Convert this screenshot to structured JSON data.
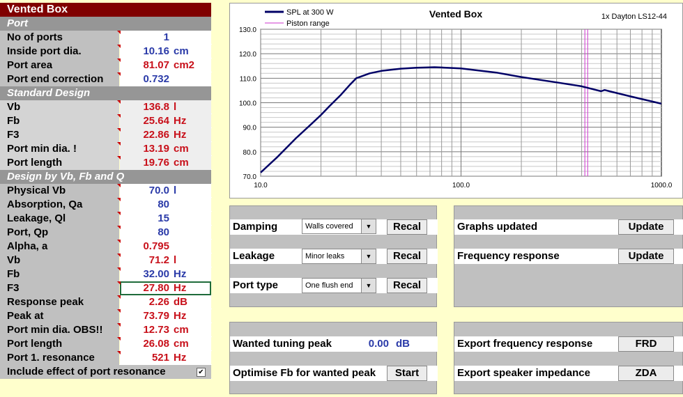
{
  "sheet": {
    "title": "Vented Box",
    "port_section": "Port",
    "port": [
      {
        "label": "No of ports",
        "value": "1",
        "unit": "",
        "color": "blue"
      },
      {
        "label": "Inside port dia.",
        "value": "10.16",
        "unit": "cm",
        "color": "blue"
      },
      {
        "label": "Port area",
        "value": "81.07",
        "unit": "cm2",
        "color": "red"
      },
      {
        "label": "Port end correction",
        "value": "0.732",
        "unit": "",
        "color": "blue"
      }
    ],
    "standard_section": "Standard Design",
    "standard": [
      {
        "label": "Vb",
        "value": "136.8",
        "unit": "l",
        "color": "red"
      },
      {
        "label": "Fb",
        "value": "25.64",
        "unit": "Hz",
        "color": "red"
      },
      {
        "label": "F3",
        "value": "22.86",
        "unit": "Hz",
        "color": "red"
      },
      {
        "label": "Port min dia. !",
        "value": "13.19",
        "unit": "cm",
        "color": "red"
      },
      {
        "label": "Port length",
        "value": "19.76",
        "unit": "cm",
        "color": "red"
      }
    ],
    "design_section": "Design by Vb, Fb and Q",
    "design": [
      {
        "label": "Physical Vb",
        "value": "70.0",
        "unit": "l",
        "color": "blue"
      },
      {
        "label": "Absorption, Qa",
        "value": "80",
        "unit": "",
        "color": "blue"
      },
      {
        "label": "Leakage, Ql",
        "value": "15",
        "unit": "",
        "color": "blue"
      },
      {
        "label": "Port, Qp",
        "value": "80",
        "unit": "",
        "color": "blue"
      },
      {
        "label": "Alpha, a",
        "value": "0.795",
        "unit": "",
        "color": "red"
      },
      {
        "label": "Vb",
        "value": "71.2",
        "unit": "l",
        "color": "red"
      },
      {
        "label": "Fb",
        "value": "32.00",
        "unit": "Hz",
        "color": "blue"
      },
      {
        "label": "F3",
        "value": "27.80",
        "unit": "Hz",
        "color": "red"
      },
      {
        "label": "Response peak",
        "value": "2.26",
        "unit": "dB",
        "color": "red"
      },
      {
        "label": "Peak at",
        "value": "73.79",
        "unit": "Hz",
        "color": "red"
      },
      {
        "label": "Port min dia. OBS!!",
        "value": "12.73",
        "unit": "cm",
        "color": "red"
      },
      {
        "label": "Port length",
        "value": "26.08",
        "unit": "cm",
        "color": "red"
      },
      {
        "label": "Port 1. resonance",
        "value": "521",
        "unit": "Hz",
        "color": "red"
      }
    ],
    "include_label": "Include effect of port resonance",
    "include_checked": true,
    "include_mark": "✔"
  },
  "chart_data": {
    "type": "line",
    "title": "Vented Box",
    "subtitle": "1x Dayton LS12-44",
    "legend": [
      {
        "name": "SPL at 300 W",
        "color": "#000066"
      },
      {
        "name": "Piston range",
        "color": "#cc33cc"
      }
    ],
    "legend_placement": "top-left",
    "xscale": "log",
    "xlim": [
      10,
      1000
    ],
    "ylim": [
      70,
      130
    ],
    "xticks": [
      "10.0",
      "100.0",
      "1000.0"
    ],
    "yticks": [
      "70.0",
      "80.0",
      "90.0",
      "100.0",
      "110.0",
      "120.0",
      "130.0"
    ],
    "grid": true,
    "piston_range_hz": 415,
    "series": [
      {
        "name": "SPL at 300 W",
        "x": [
          10,
          12,
          15,
          18,
          20,
          22,
          25,
          28,
          30,
          35,
          40,
          50,
          60,
          73.8,
          80,
          100,
          150,
          200,
          300,
          400,
          500,
          521,
          550,
          700,
          1000
        ],
        "y": [
          71.5,
          77.5,
          85.5,
          91.5,
          95.0,
          98.5,
          103.0,
          107.5,
          110.0,
          112.0,
          113.0,
          113.9,
          114.3,
          114.5,
          114.4,
          114.0,
          112.3,
          110.5,
          108.3,
          106.7,
          104.7,
          105.2,
          104.7,
          102.6,
          99.6
        ]
      }
    ]
  },
  "controls": {
    "damping_label": "Damping",
    "damping_value": "Walls covered",
    "leakage_label": "Leakage",
    "leakage_value": "Minor leaks",
    "porttype_label": "Port type",
    "porttype_value": "One flush end",
    "recal_label": "Recal",
    "dropdown_arrow": "▼",
    "graphs_label": "Graphs updated",
    "freqresp_label": "Frequency response",
    "update_label": "Update",
    "wanted_label": "Wanted tuning peak",
    "wanted_value": "0.00",
    "wanted_unit": "dB",
    "optimise_label": "Optimise Fb for wanted peak",
    "start_label": "Start",
    "export_frd_label": "Export frequency response",
    "frd_label": "FRD",
    "export_zda_label": "Export speaker impedance",
    "zda_label": "ZDA"
  }
}
